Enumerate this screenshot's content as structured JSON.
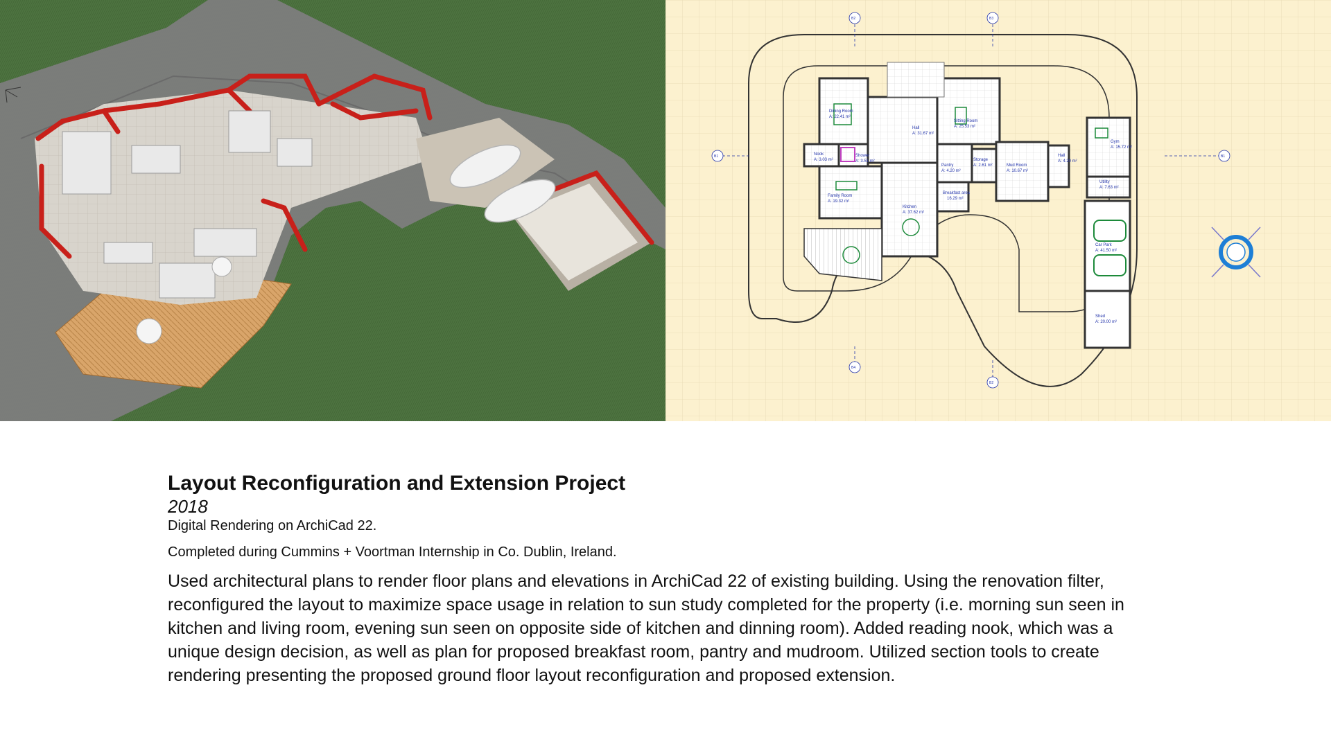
{
  "rendering": {
    "description_alt": ""
  },
  "floor_plan": {
    "rooms": [
      {
        "name": "Dining Room",
        "area": "A: 22.41 m²"
      },
      {
        "name": "Hall",
        "area": "A: 31.67 m²"
      },
      {
        "name": "Sitting Room",
        "area": "A: 25.53 m²"
      },
      {
        "name": "Nook",
        "area": "A: 3.03 m²"
      },
      {
        "name": "Shower",
        "area": "A: 3.51 m²"
      },
      {
        "name": "Pantry",
        "area": "A: 4.20 m²"
      },
      {
        "name": "Storage",
        "area": "A: 2.61 m²"
      },
      {
        "name": "Mud Room",
        "area": "A: 10.67 m²"
      },
      {
        "name": "Hall",
        "area": "A: 4.20 m²"
      },
      {
        "name": "Gym",
        "area": "A: 15.72 m²"
      },
      {
        "name": "Utility",
        "area": "A: 7.63 m²"
      },
      {
        "name": "Family Room",
        "area": "A: 19.32 m²"
      },
      {
        "name": "Kitchen",
        "area": "A: 37.62 m²"
      },
      {
        "name": "Breakfast area",
        "area": "16.29 m²"
      },
      {
        "name": "Car Park",
        "area": "A: 41.50 m²"
      },
      {
        "name": "Shed",
        "area": "A: 20.00 m²"
      }
    ],
    "grid_markers": [
      "B2",
      "B3",
      "B1",
      "B1",
      "B4",
      "B2"
    ]
  },
  "caption": {
    "title": "Layout Reconfiguration and Extension Project",
    "year": "2018",
    "medium": "Digital Rendering on ArchiCad 22.",
    "context": "Completed during Cummins + Voortman Internship in Co. Dublin, Ireland.",
    "body": "Used architectural plans to render floor plans and elevations in ArchiCad 22 of existing building. Using the renovation filter, reconfigured the layout to maximize space usage in relation to sun study completed for the property (i.e. morning sun seen in kitchen and living room, evening sun seen on opposite side of kitchen and dinning room). Added reading nook, which was a unique design decision, as well as plan for proposed breakfast room, pantry and mudroom. Utilized section tools to create rendering presenting the proposed ground floor layout reconfiguration and proposed extension."
  },
  "colors": {
    "grass": "#4a6e3a",
    "road": "#7a7a7a",
    "wall_cut": "#c8201a",
    "plan_background": "#fcf1cf",
    "plan_ink": "#2233aa"
  }
}
